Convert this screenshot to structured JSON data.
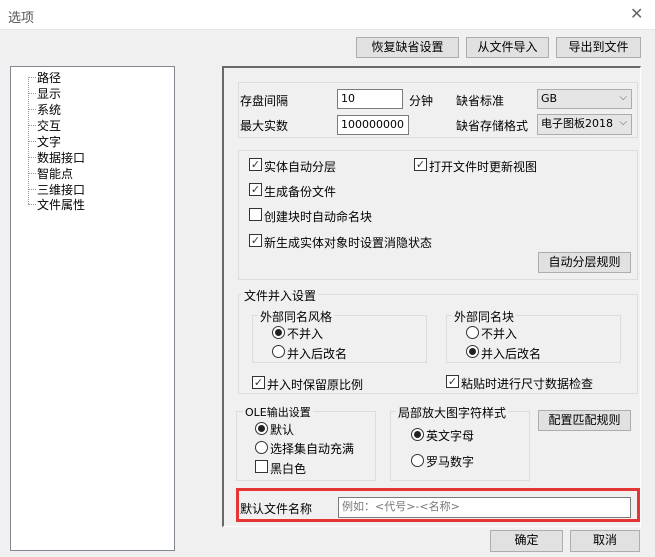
{
  "window": {
    "title": "选项",
    "close": "✕"
  },
  "toolbar": {
    "restore": "恢复缺省设置",
    "import": "从文件导入",
    "export": "导出到文件"
  },
  "tree": [
    "路径",
    "显示",
    "系统",
    "交互",
    "文字",
    "数据接口",
    "智能点",
    "三维接口",
    "文件属性"
  ],
  "general": {
    "save_interval_label": "存盘间隔",
    "save_interval": "10",
    "minutes": "分钟",
    "max_entities_label": "最大实数",
    "max_entities": "100000000",
    "default_standard_label": "缺省标准",
    "default_standard": "GB",
    "default_format_label": "缺省存储格式",
    "default_format": "电子图板2018"
  },
  "options": {
    "auto_layer": "实体自动分层",
    "update_view": "打开文件时更新视图",
    "backup": "生成备份文件",
    "auto_name_block": "创建块时自动命名块",
    "hidden_state": "新生成实体对象时设置消隐状态",
    "auto_layer_rules": "自动分层规则"
  },
  "merge": {
    "title": "文件并入设置",
    "style_title": "外部同名风格",
    "block_title": "外部同名块",
    "no_merge": "不并入",
    "rename": "并入后改名",
    "keep_scale": "并入时保留原比例",
    "paste_check": "粘贴时进行尺寸数据检查"
  },
  "ole": {
    "title": "OLE输出设置",
    "default": "默认",
    "auto_fill": "选择集自动充满",
    "bw": "黑白色"
  },
  "detail": {
    "title": "局部放大图字符样式",
    "letters": "英文字母",
    "roman": "罗马数字",
    "match_rules": "配置匹配规则"
  },
  "filename": {
    "label": "默认文件名称",
    "placeholder": "例如：<代号>-<名称>"
  },
  "footer": {
    "ok": "确定",
    "cancel": "取消"
  }
}
